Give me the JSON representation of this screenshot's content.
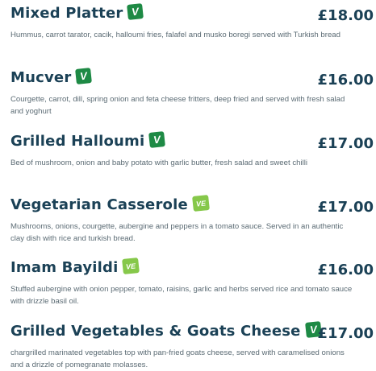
{
  "colors": {
    "heading": "#1b4156",
    "description": "#5b6b74",
    "vegan_badge": "#1e8a45",
    "vegetarian_badge": "#86c84a"
  },
  "items": [
    {
      "name": "Mixed Platter",
      "badge": "V",
      "badge_type": "vegan",
      "price": "£18.00",
      "description": "Hummus, carrot tarator, cacik, halloumi fries, falafel and musko boregi served with Turkish bread"
    },
    {
      "name": "Mucver",
      "badge": "V",
      "badge_type": "vegan",
      "price": "£16.00",
      "description": "Courgette, carrot, dill, spring onion and feta cheese fritters, deep fried and served with fresh salad and yoghurt"
    },
    {
      "name": "Grilled Halloumi",
      "badge": "V",
      "badge_type": "vegan",
      "price": "£17.00",
      "description": "Bed of mushroom, onion and baby potato with garlic butter, fresh salad and sweet chilli"
    },
    {
      "name": "Vegetarian Casserole",
      "badge": "VE",
      "badge_type": "vegetarian",
      "price": "£17.00",
      "description": "Mushrooms, onions, courgette, aubergine and peppers in a tomato sauce. Served in an authentic clay dish with rice and turkish bread."
    },
    {
      "name": "Imam Bayildi",
      "badge": "VE",
      "badge_type": "vegetarian",
      "price": "£16.00",
      "description": "Stuffed aubergine with onion pepper, tomato, raisins, garlic and herbs served rice and tomato sauce with drizzle basil oil."
    },
    {
      "name": "Grilled Vegetables & Goats Cheese",
      "badge": "V",
      "badge_type": "vegan",
      "price": "£17.00",
      "description": "chargrilled marinated vegetables top with pan-fried goats cheese, served with caramelised onions and a drizzle of pomegranate molasses."
    }
  ]
}
